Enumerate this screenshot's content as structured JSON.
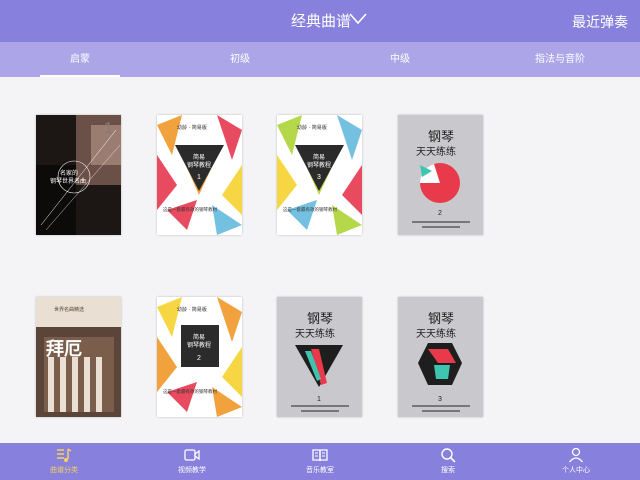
{
  "header": {
    "title": "经典曲谱",
    "recent": "最近弹奏"
  },
  "tabs": [
    {
      "label": "启蒙",
      "active": true
    },
    {
      "label": "初级",
      "active": false
    },
    {
      "label": "中级",
      "active": false
    },
    {
      "label": "指法与音阶",
      "active": false
    }
  ],
  "books": [
    {
      "style": "photo-dark",
      "texts": [
        "1",
        "名家的",
        "钢琴世界名曲"
      ]
    },
    {
      "style": "triangles-red",
      "texts": [
        "幼龄 · 简易版",
        "简易",
        "钢琴教程",
        "1",
        "这是一套最有效的钢琴教材"
      ]
    },
    {
      "style": "triangles-green",
      "texts": [
        "幼龄 · 简易版",
        "简易",
        "钢琴教程",
        "3",
        "这是一套最有效的钢琴教材"
      ]
    },
    {
      "style": "grey-pie",
      "texts": [
        "钢琴",
        "天天练练",
        "2"
      ]
    },
    {
      "style": "photo-building",
      "texts": [
        "世界名曲精选",
        "拜厄"
      ]
    },
    {
      "style": "triangles-orange",
      "texts": [
        "幼龄 · 简易版",
        "简易",
        "钢琴教程",
        "2",
        "这是一套最有效的钢琴教材"
      ]
    },
    {
      "style": "grey-triangle",
      "texts": [
        "钢琴",
        "天天练练",
        "1"
      ]
    },
    {
      "style": "grey-hexagon",
      "texts": [
        "钢琴",
        "天天练练",
        "3"
      ]
    }
  ],
  "bottom_nav": [
    {
      "label": "曲谱分类",
      "icon": "music-list-icon",
      "active": true
    },
    {
      "label": "视频教学",
      "icon": "video-camera-icon",
      "active": false
    },
    {
      "label": "音乐教室",
      "icon": "open-book-icon",
      "active": false
    },
    {
      "label": "搜索",
      "icon": "search-icon",
      "active": false
    },
    {
      "label": "个人中心",
      "icon": "person-icon",
      "active": false
    }
  ],
  "colors": {
    "header": "#8780dc",
    "tabs": "#aca6e8",
    "active_nav": "#f4d35e",
    "background": "#f4f4f6"
  }
}
